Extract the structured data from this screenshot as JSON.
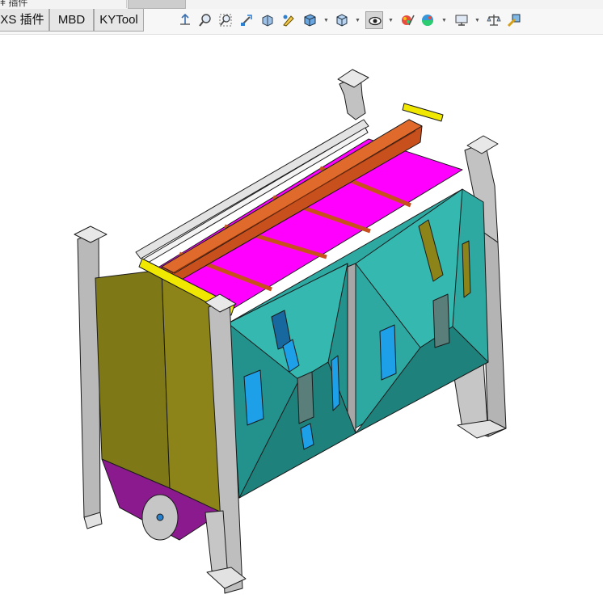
{
  "window": {
    "top_fragment": "ǂ 插件"
  },
  "tabs": [
    {
      "label": "XS 插件"
    },
    {
      "label": "MBD"
    },
    {
      "label": "KYTool"
    }
  ],
  "heads_up_toolbar": [
    {
      "icon": "view-orientation-icon"
    },
    {
      "icon": "zoom-to-fit-icon"
    },
    {
      "icon": "zoom-to-area-icon"
    },
    {
      "icon": "previous-view-icon"
    },
    {
      "icon": "section-view-icon"
    },
    {
      "icon": "dynamic-annotation-icon"
    },
    {
      "icon": "view-orientation-cube-icon"
    },
    {
      "icon": "display-style-icon"
    },
    {
      "icon": "hide-show-items-icon"
    },
    {
      "icon": "edit-appearance-icon"
    },
    {
      "icon": "apply-scene-icon"
    },
    {
      "icon": "view-settings-icon"
    },
    {
      "icon": "evaluate-icon"
    },
    {
      "icon": "measure-icon"
    }
  ],
  "colors": {
    "frame": "#b9b9b9",
    "olive_panel": "#8c8419",
    "teal_hopper": "#2ea9a2",
    "magenta_screen": "#ff00ff",
    "orange_beam": "#c8501c",
    "purple_hopper": "#8a1a8e",
    "window_blue": "#1ea0e8",
    "yellow_strip": "#f0e800"
  }
}
